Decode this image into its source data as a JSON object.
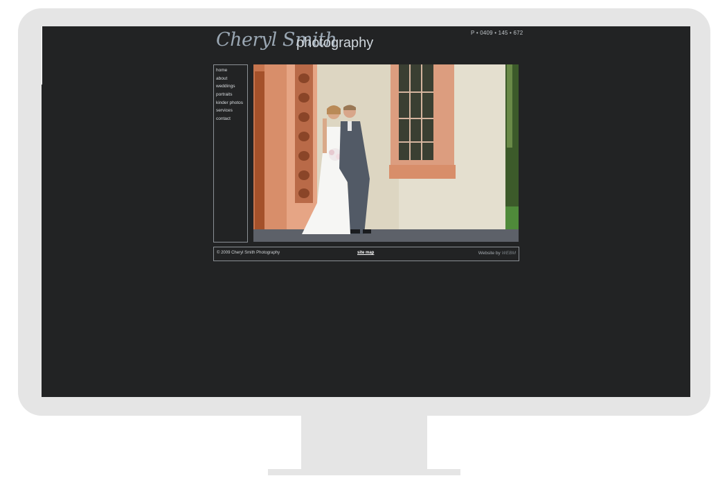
{
  "site": {
    "logo": {
      "script_text": "Cheryl Smith",
      "word_text": "photography"
    },
    "phone": "P • 0409 • 145 • 672",
    "nav": [
      {
        "label": "home"
      },
      {
        "label": "about"
      },
      {
        "label": "weddings"
      },
      {
        "label": "portraits"
      },
      {
        "label": "kinder photos"
      },
      {
        "label": "services"
      },
      {
        "label": "contact"
      }
    ],
    "footer": {
      "copyright": "© 2009 Cheryl Smith Photography",
      "sitemap": "site map",
      "credit": "Website by",
      "credit_brand": "WEBM"
    }
  },
  "colors": {
    "screen_bg": "#222324",
    "bezel": "#e5e5e5",
    "border": "#8c9196"
  }
}
